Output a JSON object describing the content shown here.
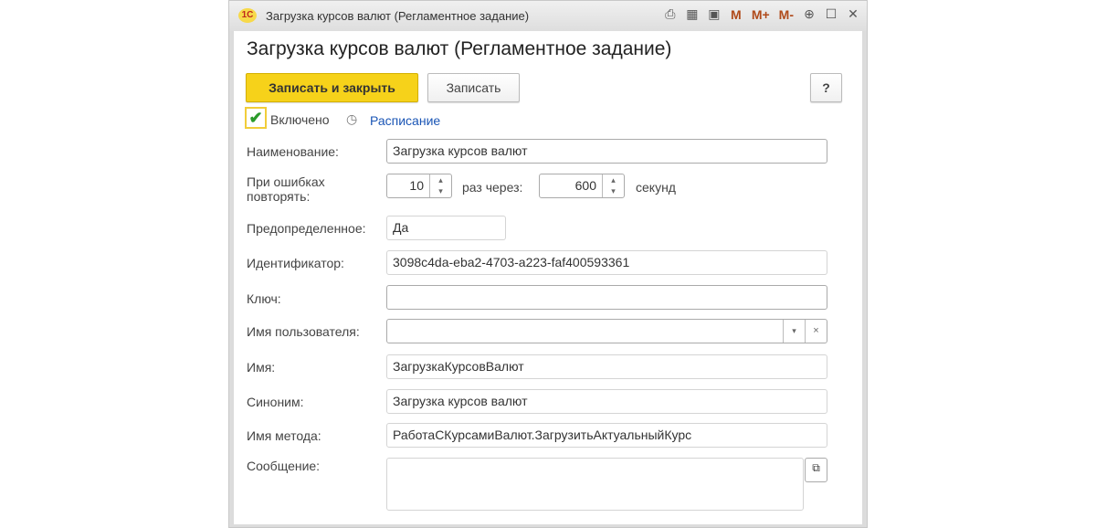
{
  "window": {
    "title": "Загрузка курсов валют (Регламентное задание)",
    "logo": "1С",
    "tools": [
      "print-icon",
      "calculator-icon",
      "calendar-icon",
      "M",
      "M+",
      "M-",
      "zoom-icon",
      "maximize-icon",
      "close-icon"
    ]
  },
  "form": {
    "heading": "Загрузка курсов валют (Регламентное задание)",
    "save_close": "Записать и закрыть",
    "save": "Записать",
    "help": "?",
    "enabled_label": "Включено",
    "schedule_link": "Расписание",
    "name_label": "Наименование:",
    "name_value": "Загрузка курсов валют",
    "retry_label": "При ошибках повторять:",
    "retry_count": "10",
    "times_through": "раз  через:",
    "retry_interval": "600",
    "seconds": "секунд",
    "predefined_label": "Предопределенное:",
    "predefined_value": "Да",
    "id_label": "Идентификатор:",
    "id_value": "3098c4da-eba2-4703-a223-faf400593361",
    "key_label": "Ключ:",
    "key_value": "",
    "user_label": "Имя пользователя:",
    "user_value": "",
    "iname_label": "Имя:",
    "iname_value": "ЗагрузкаКурсовВалют",
    "synonym_label": "Синоним:",
    "synonym_value": "Загрузка курсов валют",
    "method_label": "Имя метода:",
    "method_value": "РаботаСКурсамиВалют.ЗагрузитьАктуальныйКурс",
    "message_label": "Сообщение:",
    "message_value": ""
  }
}
